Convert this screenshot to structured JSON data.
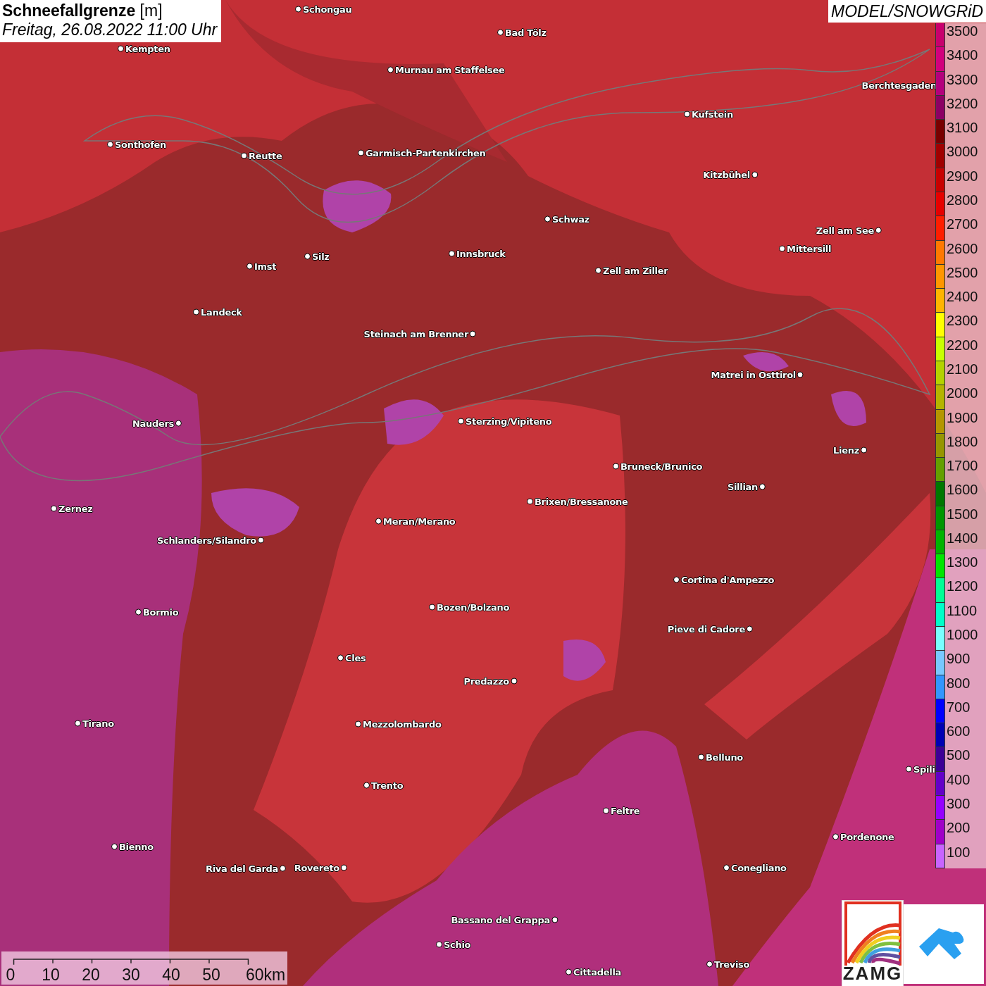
{
  "title": {
    "name": "Schneefallgrenze",
    "unit": "[m]",
    "datetime": "Freitag, 26.08.2022 11:00 Uhr"
  },
  "model": "MODEL/SNOWGRiD",
  "legend": [
    {
      "label": "3500",
      "color": "#c8006e"
    },
    {
      "label": "3400",
      "color": "#d2007d"
    },
    {
      "label": "3300",
      "color": "#b4007d"
    },
    {
      "label": "3200",
      "color": "#8c0064"
    },
    {
      "label": "3100",
      "color": "#780000"
    },
    {
      "label": "3000",
      "color": "#a00000"
    },
    {
      "label": "2900",
      "color": "#c80000"
    },
    {
      "label": "2800",
      "color": "#e60000"
    },
    {
      "label": "2700",
      "color": "#ff1e00"
    },
    {
      "label": "2600",
      "color": "#ff7800"
    },
    {
      "label": "2500",
      "color": "#ff9600"
    },
    {
      "label": "2400",
      "color": "#ffb400"
    },
    {
      "label": "2300",
      "color": "#ffff00"
    },
    {
      "label": "2200",
      "color": "#c8ff00"
    },
    {
      "label": "2100",
      "color": "#b4d200"
    },
    {
      "label": "2000",
      "color": "#b4b400"
    },
    {
      "label": "1900",
      "color": "#b49600"
    },
    {
      "label": "1800",
      "color": "#969600"
    },
    {
      "label": "1700",
      "color": "#64a000"
    },
    {
      "label": "1600",
      "color": "#007800"
    },
    {
      "label": "1500",
      "color": "#009600"
    },
    {
      "label": "1400",
      "color": "#00b400"
    },
    {
      "label": "1300",
      "color": "#00e600"
    },
    {
      "label": "1200",
      "color": "#00ff96"
    },
    {
      "label": "1100",
      "color": "#00ffc8"
    },
    {
      "label": "1000",
      "color": "#78ffff"
    },
    {
      "label": "900",
      "color": "#78c8ff"
    },
    {
      "label": "800",
      "color": "#3296ff"
    },
    {
      "label": "700",
      "color": "#0000ff"
    },
    {
      "label": "600",
      "color": "#0000b4"
    },
    {
      "label": "500",
      "color": "#3c0096"
    },
    {
      "label": "400",
      "color": "#6400c8"
    },
    {
      "label": "300",
      "color": "#9600ff"
    },
    {
      "label": "200",
      "color": "#a000c8"
    },
    {
      "label": "100",
      "color": "#c864ff"
    }
  ],
  "cities": [
    "Schongau",
    "Bad Tölz",
    "Kempten",
    "Murnau am Staffelsee",
    "Berchtesgaden",
    "Kufstein",
    "Sonthofen",
    "Reutte",
    "Garmisch-Partenkirchen",
    "Kitzbühel",
    "Schwaz",
    "Zell am See",
    "Innsbruck",
    "Mittersill",
    "Silz",
    "Imst",
    "Zell am Ziller",
    "Landeck",
    "Steinach am Brenner",
    "Matrei in Osttirol",
    "Nauders",
    "Sterzing/Vipiteno",
    "Lienz",
    "Bruneck/Brunico",
    "Sillian",
    "Brixen/Bressanone",
    "Zernez",
    "Meran/Merano",
    "Schlanders/Silandro",
    "Cortina d'Ampezzo",
    "Bozen/Bolzano",
    "Bormio",
    "Pieve di Cadore",
    "Cles",
    "Predazzo",
    "Tirano",
    "Mezzolombardo",
    "Belluno",
    "Spili",
    "Trento",
    "Feltre",
    "Pordenone",
    "Bienno",
    "Riva del Garda",
    "Rovereto",
    "Conegliano",
    "Bassano del Grappa",
    "Schio",
    "Treviso",
    "Cittadella"
  ],
  "scale": [
    "0",
    "10",
    "20",
    "30",
    "40",
    "50",
    "60km"
  ],
  "logo": {
    "text": "ZAMG"
  }
}
